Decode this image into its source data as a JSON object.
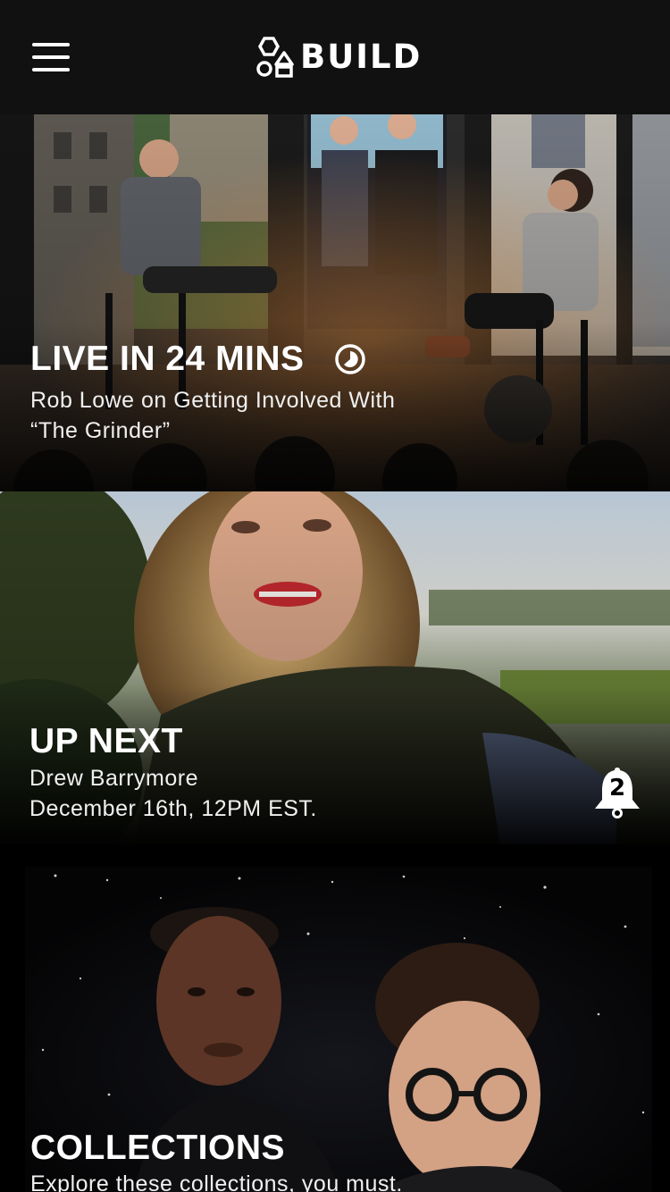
{
  "header": {
    "brand": "BUILD",
    "menu_icon": "hamburger-menu-icon",
    "logo_icon": "build-shapes-logo-icon"
  },
  "live_card": {
    "title": "LIVE IN 24 MINS",
    "subtitle_line1": "Rob Lowe on Getting Involved With",
    "subtitle_line2": "“The Grinder”",
    "status_icon": "countdown-clock-icon"
  },
  "next_card": {
    "title": "UP NEXT",
    "guest": "Drew Barrymore",
    "datetime": "December 16th, 12PM EST.",
    "reminder_icon": "bell-icon",
    "reminder_count": "2"
  },
  "collections_card": {
    "title": "COLLECTIONS",
    "subtitle": "Explore these collections, you must."
  },
  "colors": {
    "header_bg": "#111111",
    "background": "#000000",
    "text": "#ffffff"
  }
}
